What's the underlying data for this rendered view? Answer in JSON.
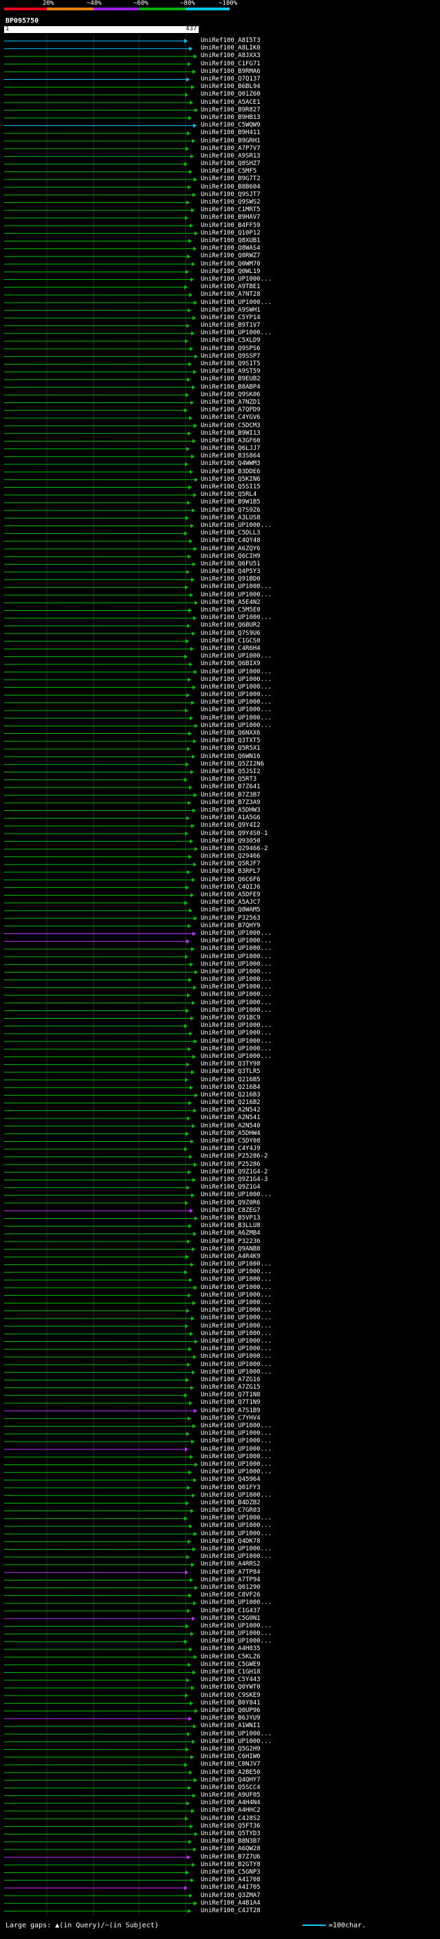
{
  "scale": {
    "labels": [
      "20%",
      "~40%",
      "~60%",
      "~80%",
      "~100%"
    ],
    "colors": [
      "#e8001c",
      "#ff8000",
      "#a020ff",
      "#00b000",
      "#00c8ff"
    ]
  },
  "query": {
    "title": "BP095750",
    "start": "1",
    "end": "437"
  },
  "footer": {
    "gaps": "Large gaps: ▲(in Query)/~(in Subject)",
    "scale": "=100char."
  },
  "hits": [
    "UniRef100_A8I5T3",
    "UniRef100_A8LIK0",
    "UniRef100_A8JXX3",
    "UniRef100_C1FG71",
    "UniRef100_B9RMA6",
    "UniRef100_Q7Q137",
    "UniRef100_B6BL94",
    "UniRef100_Q01Z60",
    "UniRef100_A5ACE1",
    "UniRef100_B9R827",
    "UniRef100_B9HB13",
    "UniRef100_C5WQW9",
    "UniRef100_B9H411",
    "UniRef100_B9GRH1",
    "UniRef100_A7P7V7",
    "UniRef100_A9SR13",
    "UniRef100_Q8SHZ7",
    "UniRef100_C5MF5",
    "UniRef100_B9G7T2",
    "UniRef100_B8B604",
    "UniRef100_Q9SJT7",
    "UniRef100_Q9SWS2",
    "UniRef100_C1MRT5",
    "UniRef100_B9HAV7",
    "UniRef100_B4FF59",
    "UniRef100_Q10P12",
    "UniRef100_Q8XUB1",
    "UniRef100_Q8WAS4",
    "UniRef100_Q8RWZ7",
    "UniRef100_Q0WM70",
    "UniRef100_Q0WL19",
    "UniRef100_UP1000...",
    "UniRef100_A9TBE1",
    "UniRef100_A7NT28",
    "UniRef100_UP1000...",
    "UniRef100_A9SWH1",
    "UniRef100_C5YP14",
    "UniRef100_B9T1V7",
    "UniRef100_UP1000...",
    "UniRef100_C5XLD9",
    "UniRef100_Q9SPS6",
    "UniRef100_Q9SSP7",
    "UniRef100_Q9S1T5",
    "UniRef100_A9ST59",
    "UniRef100_B9EUB2",
    "UniRef100_B8ABP4",
    "UniRef100_Q9SK06",
    "UniRef100_A7NZD1",
    "UniRef100_A7QPD9",
    "UniRef100_C4YGV6",
    "UniRef100_C5DCM3",
    "UniRef100_B9WI13",
    "UniRef100_A3GF60",
    "UniRef100_Q6LJJ7",
    "UniRef100_B3S864",
    "UniRef100_Q4WWM3",
    "UniRef100_B3DDE6",
    "UniRef100_Q5KIN6",
    "UniRef100_Q5SI15",
    "UniRef100_Q5RL4",
    "UniRef100_B9W1B5",
    "UniRef100_Q7S9Z6",
    "UniRef100_A3LUS8",
    "UniRef100_UP1000...",
    "UniRef100_C5DLL3",
    "UniRef100_C4QY48",
    "UniRef100_A6ZQY6",
    "UniRef100_Q6CIH9",
    "UniRef100_Q6FU51",
    "UniRef100_Q4P5Y3",
    "UniRef100_Q91BD0",
    "UniRef100_UP1000...",
    "UniRef100_UP1000...",
    "UniRef100_A5E4N2",
    "UniRef100_C5M5E0",
    "UniRef100_UP1000...",
    "UniRef100_Q6BUR2",
    "UniRef100_Q7S9U6",
    "UniRef100_C1GCS0",
    "UniRef100_C4R6H4",
    "UniRef100_UP1000...",
    "UniRef100_Q6BIX9",
    "UniRef100_UP1000...",
    "UniRef100_UP1000...",
    "UniRef100_UP1000...",
    "UniRef100_UP1000...",
    "UniRef100_UP1000...",
    "UniRef100_UP1000...",
    "UniRef100_UP1000...",
    "UniRef100_UP1000...",
    "UniRef100_Q6NXX6",
    "UniRef100_Q3TXT5",
    "UniRef100_Q5R5X1",
    "UniRef100_Q6WN16",
    "UniRef100_Q5ZI2N6",
    "UniRef100_Q5JSI2",
    "UniRef100_Q5RT3",
    "UniRef100_B7Z641",
    "UniRef100_B7Z3B7",
    "UniRef100_B7Z3A9",
    "UniRef100_A5DHW3",
    "UniRef100_A1A5G6",
    "UniRef100_Q9Y4I2",
    "UniRef100_Q9Y4S0-1",
    "UniRef100_Q93050",
    "UniRef100_Q29466-2",
    "UniRef100_Q29466",
    "UniRef100_Q5RJF7",
    "UniRef100_B3RPL7",
    "UniRef100_Q6C6F6",
    "UniRef100_C4QIJ6",
    "UniRef100_A5DFE9",
    "UniRef100_A5AJC7",
    "UniRef100_Q8WAM5",
    "UniRef100_P32563",
    "UniRef100_B7QHY9",
    "UniRef100_UP1000...",
    "UniRef100_UP1000...",
    "UniRef100_UP1000...",
    "UniRef100_UP1000...",
    "UniRef100_UP1000...",
    "UniRef100_UP1000...",
    "UniRef100_UP1000...",
    "UniRef100_UP1000...",
    "UniRef100_UP1000...",
    "UniRef100_UP1000...",
    "UniRef100_UP1000...",
    "UniRef100_Q91BC9",
    "UniRef100_UP1000...",
    "UniRef100_UP1000...",
    "UniRef100_UP1000...",
    "UniRef100_UP1000...",
    "UniRef100_UP1000...",
    "UniRef100_Q3TY98",
    "UniRef100_Q3TLR5",
    "UniRef100_Q216B5",
    "UniRef100_Q216B4",
    "UniRef100_Q216B3",
    "UniRef100_Q216B2",
    "UniRef100_A2N542",
    "UniRef100_A2N541",
    "UniRef100_A2N540",
    "UniRef100_A5DHW4",
    "UniRef100_C5DY08",
    "UniRef100_C4Y4J9",
    "UniRef100_P25286-2",
    "UniRef100_P25286",
    "UniRef100_Q9Z1G4-2",
    "UniRef100_Q9Z1G4-3",
    "UniRef100_Q9Z1G4",
    "UniRef100_UP1000...",
    "UniRef100_Q9Z0R6",
    "UniRef100_C8ZEG7",
    "UniRef100_B5VP13",
    "UniRef100_B3LLU8",
    "UniRef100_A6ZMB4",
    "UniRef100_P32236",
    "UniRef100_Q9ANB8",
    "UniRef100_A4R4K9",
    "UniRef100_UP1000...",
    "UniRef100_UP1000...",
    "UniRef100_UP1000...",
    "UniRef100_UP1000...",
    "UniRef100_UP1000...",
    "UniRef100_UP1000...",
    "UniRef100_UP1000...",
    "UniRef100_UP1000...",
    "UniRef100_UP1000...",
    "UniRef100_UP1000...",
    "UniRef100_UP1000...",
    "UniRef100_UP1000...",
    "UniRef100_UP1000...",
    "UniRef100_UP1000...",
    "UniRef100_UP1000...",
    "UniRef100_A7ZG16",
    "UniRef100_A7ZG15",
    "UniRef100_Q7T1N8",
    "UniRef100_Q7T1N9",
    "UniRef100_A7S1B9",
    "UniRef100_C7YHV4",
    "UniRef100_UP1000...",
    "UniRef100_UP1000...",
    "UniRef100_UP1000...",
    "UniRef100_UP1000...",
    "UniRef100_UP1000...",
    "UniRef100_UP1000...",
    "UniRef100_UP1000...",
    "UniRef100_Q45964",
    "UniRef100_Q01FY3",
    "UniRef100_UP1000...",
    "UniRef100_B4DZB2",
    "UniRef100_C7GR03",
    "UniRef100_UP1000...",
    "UniRef100_UP1000...",
    "UniRef100_UP1000...",
    "UniRef100_Q4DK78",
    "UniRef100_UP1000...",
    "UniRef100_UP1000...",
    "UniRef100_A4RRS2",
    "UniRef100_A7TP84",
    "UniRef100_A7TP94",
    "UniRef100_Q01290",
    "UniRef100_C8VF26",
    "UniRef100_UP1000...",
    "UniRef100_C1G437",
    "UniRef100_C5G0N1",
    "UniRef100_UP1000...",
    "UniRef100_UP1000...",
    "UniRef100_UP1000...",
    "UniRef100_A4H035",
    "UniRef100_C5KLZ6",
    "UniRef100_C5GWE9",
    "UniRef100_C1GH18",
    "UniRef100_C5Y443",
    "UniRef100_Q0YWT0",
    "UniRef100_C9SKE9",
    "UniRef100_B0Y841",
    "UniRef100_Q0UP96",
    "UniRef100_B6JYU9",
    "UniRef100_A1WNI1",
    "UniRef100_UP1000...",
    "UniRef100_UP1000...",
    "UniRef100_Q5G2H9",
    "UniRef100_C6HIW0",
    "UniRef100_C0NJV7",
    "UniRef100_A2BE50",
    "UniRef100_Q4QHY7",
    "UniRef100_Q5SCC4",
    "UniRef100_A9UF05",
    "UniRef100_A4H4N4",
    "UniRef100_A4HHC2",
    "UniRef100_C4J8S2",
    "UniRef100_Q5FT36",
    "UniRef100_Q5TYD3",
    "UniRef100_B8N3B7",
    "UniRef100_A6QW28",
    "UniRef100_B7Z7U6",
    "UniRef100_B2GTY8",
    "UniRef100_C5GNP3",
    "UniRef100_A41708",
    "UniRef100_A4I705",
    "UniRef100_Q3ZMA7",
    "UniRef100_A4B1A4",
    "UniRef100_C4JT28"
  ]
}
